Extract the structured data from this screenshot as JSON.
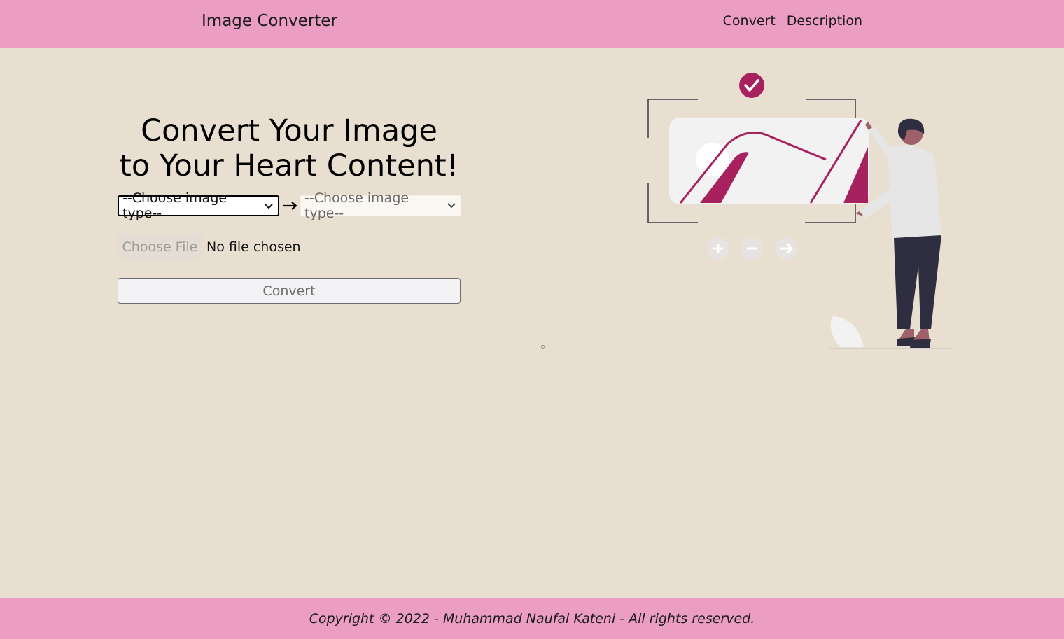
{
  "nav": {
    "brand": "Image Converter",
    "links": [
      "Convert",
      "Description"
    ]
  },
  "hero": {
    "title_line1": "Convert Your Image",
    "title_line2": "to Your Heart Content!"
  },
  "form": {
    "from_select_value": "--Choose image type--",
    "to_select_value": "--Choose image type--",
    "arrow_icon": "long-right-arrow-icon",
    "file_button_label": "Choose File",
    "file_status": "No file chosen",
    "submit_label": "Convert"
  },
  "illustration": {
    "icons": [
      "check-icon",
      "plus-icon",
      "minus-icon",
      "right-arrow-icon"
    ]
  },
  "footer": {
    "text": "Copyright © 2022 - Muhammad Naufal Kateni - All rights reserved."
  },
  "colors": {
    "nav_bg": "#eb9dc3",
    "page_bg": "#e9dfd0",
    "accent": "#a8215f",
    "figure_dark": "#2f2e41"
  }
}
